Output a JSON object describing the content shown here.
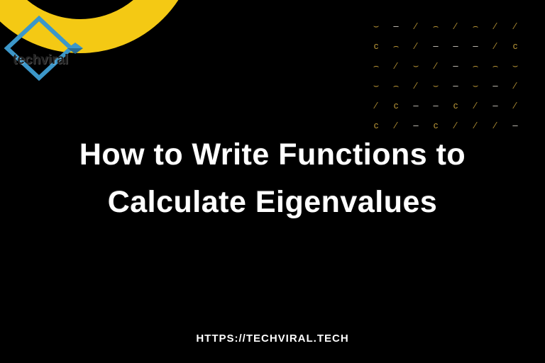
{
  "logo": {
    "text": "techviral"
  },
  "headline": "How to Write Functions to Calculate Eigenvalues",
  "footer_url": "HTTPS://TECHVIRAL.TECH",
  "pattern_glyphs": [
    "⌣",
    "–",
    "⁄",
    "⌢",
    "⁄",
    "⌢",
    "⁄",
    "⁄",
    "c",
    "⌢",
    "⁄",
    "–",
    "–",
    "–",
    "⁄",
    "c",
    "⌢",
    "⁄",
    "⌣",
    "⁄",
    "–",
    "⌢",
    "⌢",
    "⌣",
    "⌣",
    "⌢",
    "⁄",
    "⌣",
    "–",
    "⌣",
    "–",
    "⁄",
    "⁄",
    "c",
    "–",
    "–",
    "c",
    "⁄",
    "–",
    "⁄",
    "c",
    "⁄",
    "–",
    "c",
    "⁄",
    "⁄",
    "⁄",
    "–"
  ]
}
